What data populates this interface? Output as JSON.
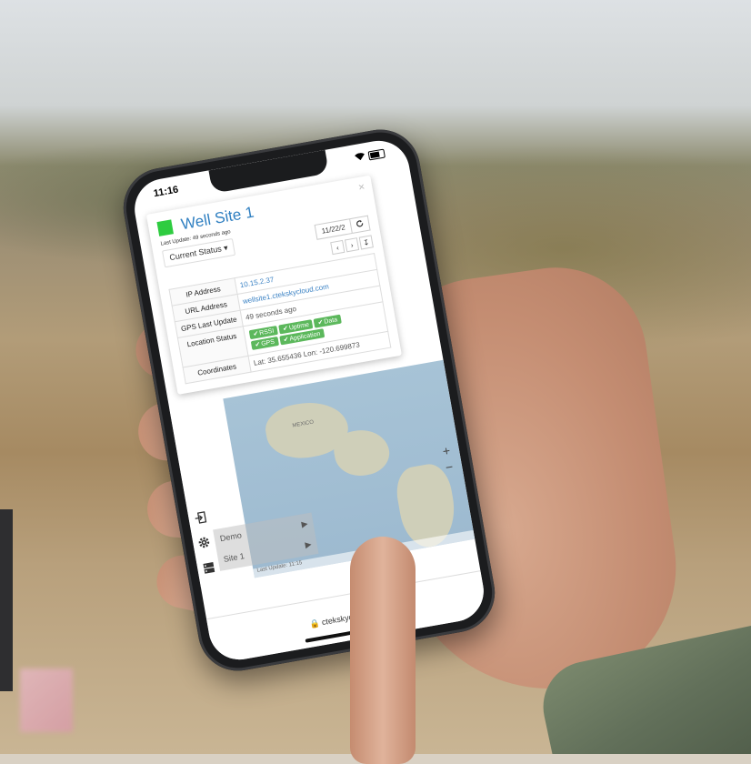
{
  "status_bar": {
    "time": "11:16"
  },
  "popup": {
    "title": "Well Site 1",
    "status_color": "#2ecc40",
    "last_update": "Last Update: 49 seconds ago",
    "view_dropdown": "Current Status ▾",
    "date_value": "11/22/2",
    "refresh_icon": "refresh-icon",
    "close_glyph": "×",
    "nav": {
      "prev": "‹",
      "next": "›",
      "export": "↧"
    },
    "rows": {
      "ip_label": "IP Address",
      "ip_value": "10.15.2.37",
      "url_label": "URL Address",
      "url_value": "wellsite1.ctekskycloud.com",
      "gps_label": "GPS Last Update",
      "gps_value": "49 seconds ago",
      "status_label": "Location Status",
      "coords_label": "Coordinates",
      "coords_value": "Lat: 35.655436 Lon: -120.699873"
    },
    "badges": [
      {
        "label": "RSSI"
      },
      {
        "label": "Uptime"
      },
      {
        "label": "Data"
      },
      {
        "label": "GPS"
      },
      {
        "label": "Application"
      }
    ]
  },
  "map": {
    "label_mexico": "MEXICO",
    "zoom_in": "+",
    "zoom_out": "−",
    "footer": "Last Update: 11:15"
  },
  "site_list": [
    {
      "name": "Demo",
      "arrow": "▶"
    },
    {
      "name": "Site 1",
      "arrow": "▶"
    }
  ],
  "bottom_bar": {
    "text": "🔒 ctekskycloud.com"
  }
}
